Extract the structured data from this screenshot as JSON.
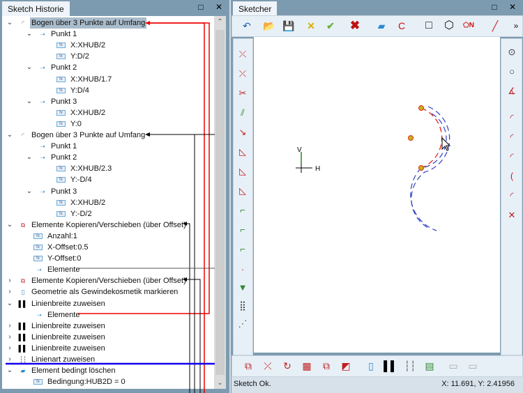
{
  "left_panel": {
    "title": "Sketch Historie",
    "maximize": "□",
    "close": "✕"
  },
  "tree": [
    {
      "level": 0,
      "exp": "v",
      "icon": "arc-icon",
      "label": "Bogen über 3 Punkte auf Umfang",
      "selected": true
    },
    {
      "level": 1,
      "exp": "v",
      "icon": "point-icon",
      "label": "Punkt 1"
    },
    {
      "level": 2,
      "exp": "",
      "icon": "fx-icon",
      "label": "X:XHUB/2"
    },
    {
      "level": 2,
      "exp": "",
      "icon": "fx-icon",
      "label": "Y:D/2"
    },
    {
      "level": 1,
      "exp": "v",
      "icon": "point-icon",
      "label": "Punkt 2"
    },
    {
      "level": 2,
      "exp": "",
      "icon": "fx-icon",
      "label": "X:XHUB/1.7"
    },
    {
      "level": 2,
      "exp": "",
      "icon": "fx-icon",
      "label": "Y:D/4"
    },
    {
      "level": 1,
      "exp": "v",
      "icon": "point-icon",
      "label": "Punkt 3"
    },
    {
      "level": 2,
      "exp": "",
      "icon": "fx-icon",
      "label": "X:XHUB/2"
    },
    {
      "level": 2,
      "exp": "",
      "icon": "fx-icon",
      "label": "Y:0"
    },
    {
      "level": 0,
      "exp": "v",
      "icon": "arc-icon",
      "label": "Bogen über 3 Punkte auf Umfang"
    },
    {
      "level": 1,
      "exp": "",
      "icon": "point-ref-icon",
      "label": "Punkt 1"
    },
    {
      "level": 1,
      "exp": "v",
      "icon": "point-icon",
      "label": "Punkt 2"
    },
    {
      "level": 2,
      "exp": "",
      "icon": "fx-icon",
      "label": "X:XHUB/2.3"
    },
    {
      "level": 2,
      "exp": "",
      "icon": "fx-icon",
      "label": "Y:-D/4"
    },
    {
      "level": 1,
      "exp": "v",
      "icon": "point-icon",
      "label": "Punkt 3"
    },
    {
      "level": 2,
      "exp": "",
      "icon": "fx-icon",
      "label": "X:XHUB/2"
    },
    {
      "level": 2,
      "exp": "",
      "icon": "fx-icon",
      "label": "Y:-D/2"
    },
    {
      "level": 0,
      "exp": "v",
      "icon": "copy-move-icon",
      "label": "Elemente Kopieren/Verschieben (über Offset)"
    },
    {
      "level": 1.5,
      "exp": "",
      "icon": "fx-icon",
      "label": "Anzahl:1"
    },
    {
      "level": 1.5,
      "exp": "",
      "icon": "fx-icon",
      "label": "X-Offset:0.5"
    },
    {
      "level": 1.5,
      "exp": "",
      "icon": "fx-icon",
      "label": "Y-Offset:0"
    },
    {
      "level": 1.5,
      "exp": "",
      "icon": "elements-ref-icon",
      "label": "Elemente"
    },
    {
      "level": 0,
      "exp": ">",
      "icon": "copy-move-icon",
      "label": "Elemente Kopieren/Verschieben (über Offset)"
    },
    {
      "level": 0,
      "exp": ">",
      "icon": "thread-cosmetic-icon",
      "label": "Geometrie als Gewindekosmetik markieren"
    },
    {
      "level": 0,
      "exp": "v",
      "icon": "line-width-icon",
      "label": "Linienbreite zuweisen"
    },
    {
      "level": 1.5,
      "exp": "",
      "icon": "elements-ref-icon",
      "label": "Elemente"
    },
    {
      "level": 0,
      "exp": ">",
      "icon": "line-width-icon",
      "label": "Linienbreite zuweisen"
    },
    {
      "level": 0,
      "exp": ">",
      "icon": "line-width-icon",
      "label": "Linienbreite zuweisen"
    },
    {
      "level": 0,
      "exp": ">",
      "icon": "line-width-icon",
      "label": "Linienbreite zuweisen"
    },
    {
      "level": 0,
      "exp": ">",
      "icon": "line-type-icon",
      "label": "Linienart zuweisen"
    },
    {
      "level": 0,
      "exp": "v",
      "icon": "conditional-delete-icon",
      "label": "Element bedingt löschen"
    },
    {
      "level": 1.5,
      "exp": "",
      "icon": "fx-icon",
      "label": "Bedingung:HUB2D = 0"
    }
  ],
  "right_panel": {
    "title": "Sketcher",
    "maximize": "□",
    "close": "✕",
    "more": "»"
  },
  "canvas": {
    "axis_v": "V",
    "axis_h": "H"
  },
  "status": {
    "text": "Sketch Ok.",
    "coords": "X: 11.691, Y: 2.41956"
  },
  "colors": {
    "accent": "#7d9bb0",
    "red": "#e02020",
    "blue": "#1010e0",
    "dash_blue": "#3040c0"
  }
}
